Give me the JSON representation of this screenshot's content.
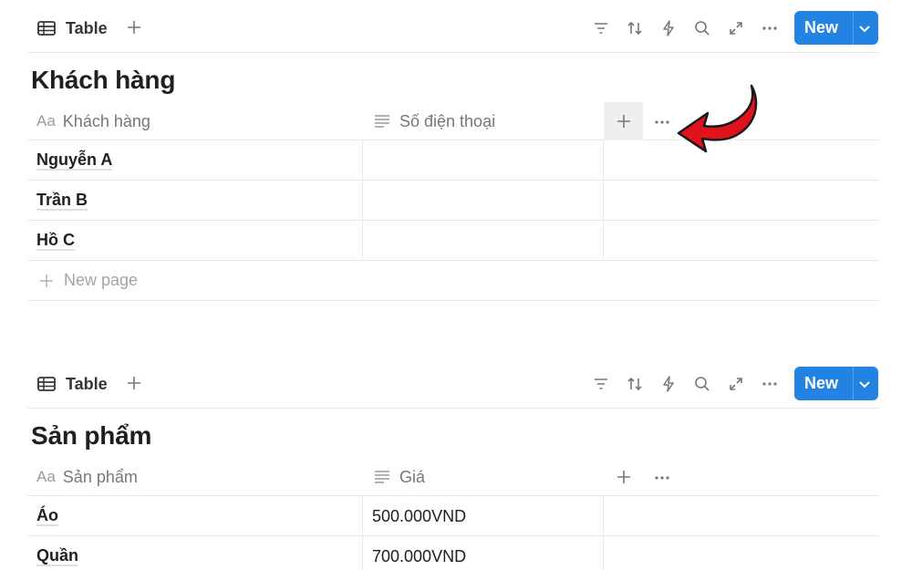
{
  "icons": {
    "table": "table-icon",
    "add_view": "plus-icon",
    "filter": "filter-icon",
    "sort": "sort-icon",
    "automation": "lightning-icon",
    "search": "search-icon",
    "expand": "expand-icon",
    "more": "more-dots-icon",
    "title_property": "Aa",
    "text_property": "text-lines-icon",
    "dropdown": "chevron-down-icon"
  },
  "colors": {
    "accent": "#2383e2",
    "annotation_arrow": "#e0121b"
  },
  "db1": {
    "view_tab": "Table",
    "new_button": "New",
    "title": "Khách hàng",
    "columns": [
      "Khách hàng",
      "Số điện thoại"
    ],
    "title_prefix": "Aa",
    "rows": [
      {
        "name": "Nguyễn A",
        "value": ""
      },
      {
        "name": "Trần B",
        "value": ""
      },
      {
        "name": "Hồ C",
        "value": ""
      }
    ],
    "new_page": "New page"
  },
  "db2": {
    "view_tab": "Table",
    "new_button": "New",
    "title": "Sản phẩm",
    "columns": [
      "Sản phẩm",
      "Giá"
    ],
    "title_prefix": "Aa",
    "rows": [
      {
        "name": "Áo",
        "value": "500.000VND"
      },
      {
        "name": "Quần",
        "value": "700.000VND"
      }
    ]
  }
}
